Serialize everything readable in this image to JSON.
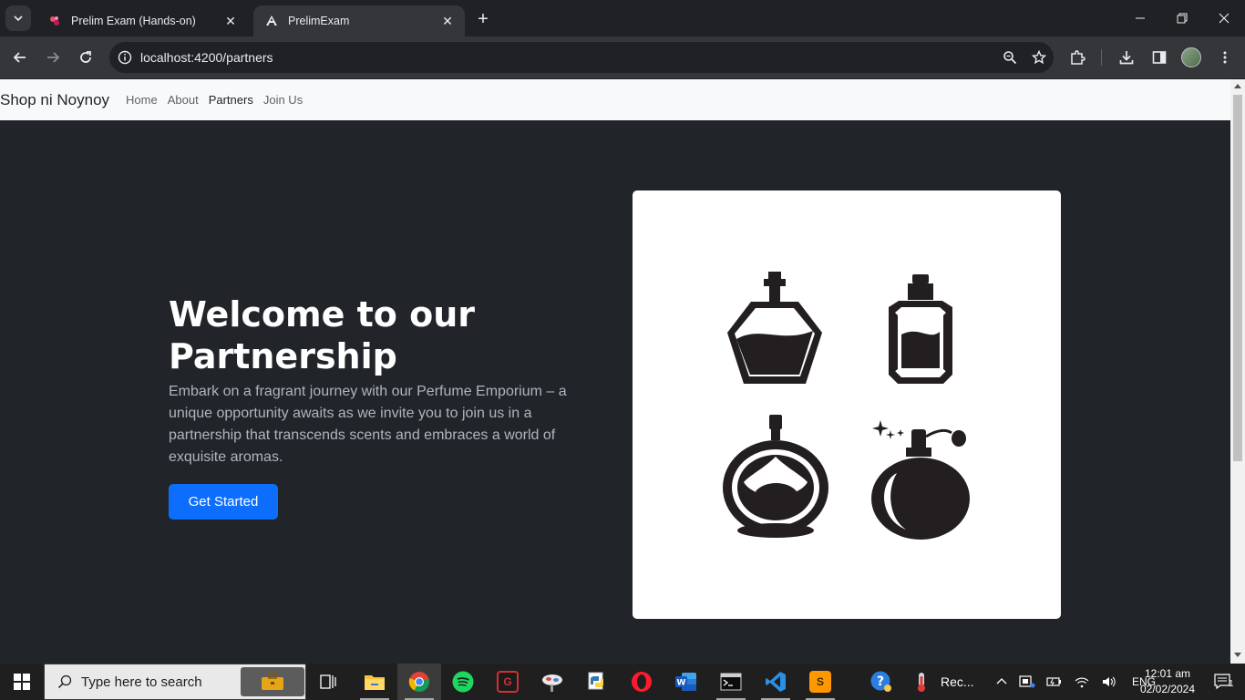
{
  "browser": {
    "tabs": [
      {
        "title": "Prelim Exam (Hands-on)",
        "icon": "google-forms-icon",
        "active": false
      },
      {
        "title": "PrelimExam",
        "icon": "angular-icon",
        "active": true
      }
    ],
    "url": "localhost:4200/partners"
  },
  "site": {
    "brand": "Shop ni Noynoy",
    "nav": [
      {
        "label": "Home"
      },
      {
        "label": "About"
      },
      {
        "label": "Partners"
      },
      {
        "label": "Join Us"
      }
    ]
  },
  "hero": {
    "title": "Welcome to our Partnership",
    "text": "Embark on a fragrant journey with our Perfume Emporium – a unique opportunity awaits as we invite you to join us in a partnership that transcends scents and embraces a world of exquisite aromas.",
    "button": "Get Started",
    "image": "perfume-bottles-illustration"
  },
  "taskbar": {
    "search_placeholder": "Type here to search",
    "pinned": [
      "task-view-icon",
      "file-explorer-icon",
      "chrome-icon",
      "spotify-icon",
      "game-app-icon",
      "photo-app-icon",
      "python-icon",
      "opera-icon",
      "word-icon",
      "terminal-icon",
      "vscode-icon",
      "sublime-text-icon",
      "help-icon",
      "recording-app-icon"
    ],
    "running_label": "Rec...",
    "language": "ENG",
    "time": "12:01 am",
    "date": "02/02/2024",
    "notifications": "1"
  },
  "colors": {
    "hero_bg": "#212529",
    "primary": "#0d6efd",
    "navbar_bg": "#f8f9fa"
  }
}
